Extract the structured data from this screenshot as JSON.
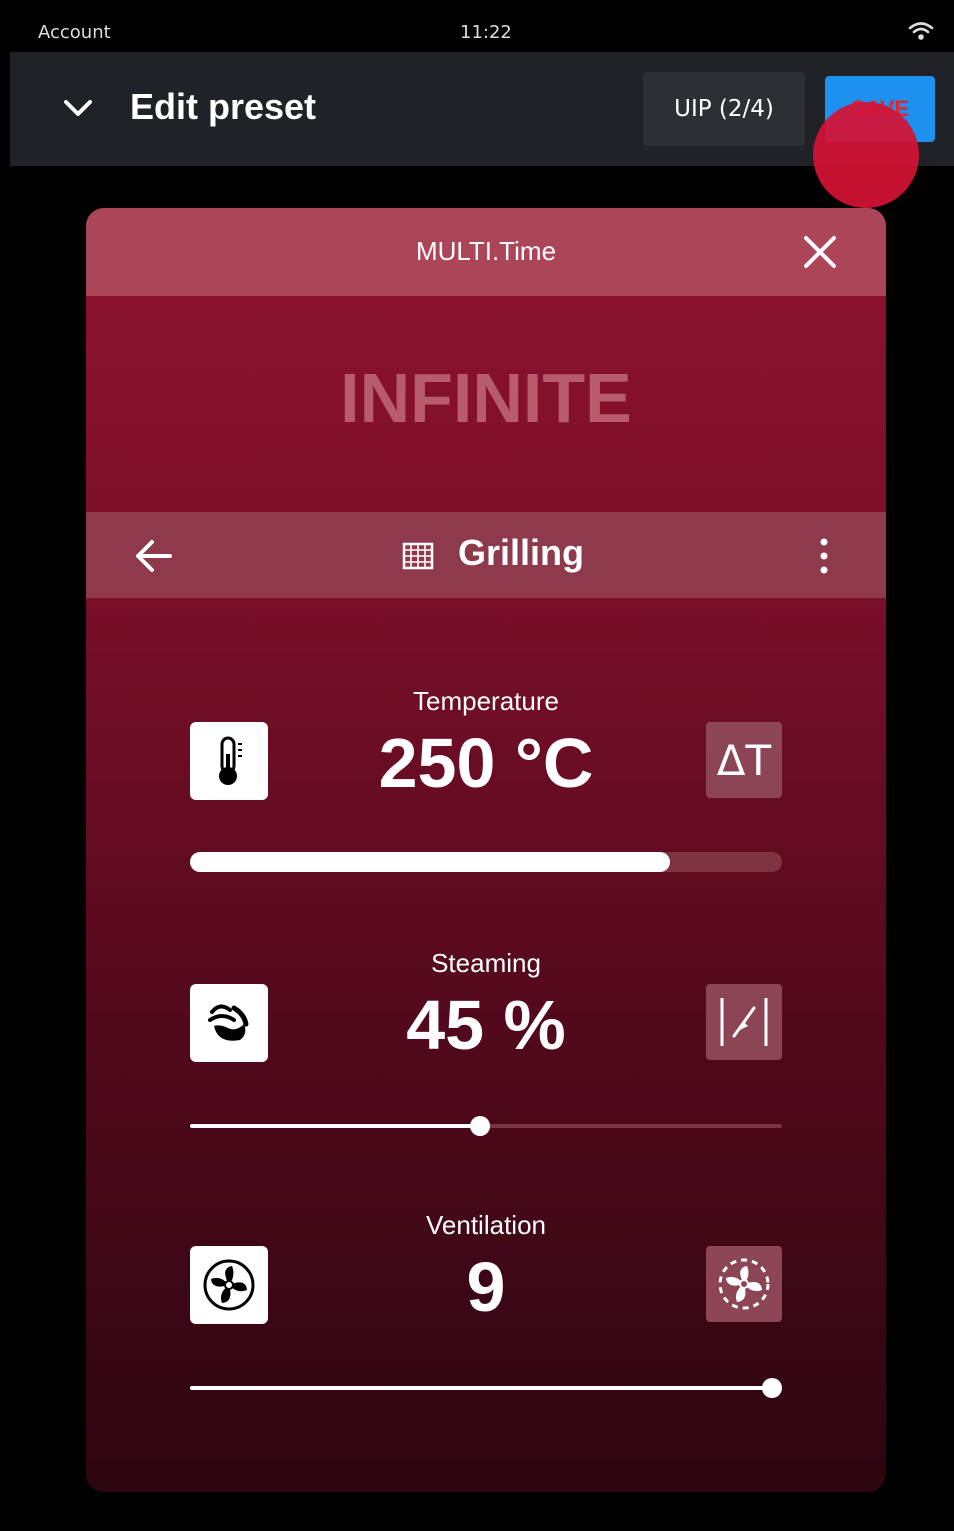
{
  "status_bar": {
    "account": "Account",
    "time": "11:22"
  },
  "header": {
    "title": "Edit preset",
    "step_label": "UIP (2/4)",
    "save_label": "SAVE"
  },
  "card": {
    "title": "MULTI.Time",
    "duration_label": "INFINITE",
    "program": {
      "name": "Grilling",
      "icon": "grid-icon"
    }
  },
  "parameters": {
    "temperature": {
      "label": "Temperature",
      "value": "250 °C",
      "mode_label": "ΔT",
      "level_fraction": 0.81
    },
    "steaming": {
      "label": "Steaming",
      "value": "45 %",
      "level_fraction": 0.49
    },
    "ventilation": {
      "label": "Ventilation",
      "value": "9",
      "level_fraction": 1.0
    }
  },
  "colors": {
    "header_bg": "#1f2226",
    "save_button": "#1e90ef",
    "card_top": "#ad4559",
    "card_accent": "#8e1230",
    "touch_indicator": "#d51234"
  }
}
